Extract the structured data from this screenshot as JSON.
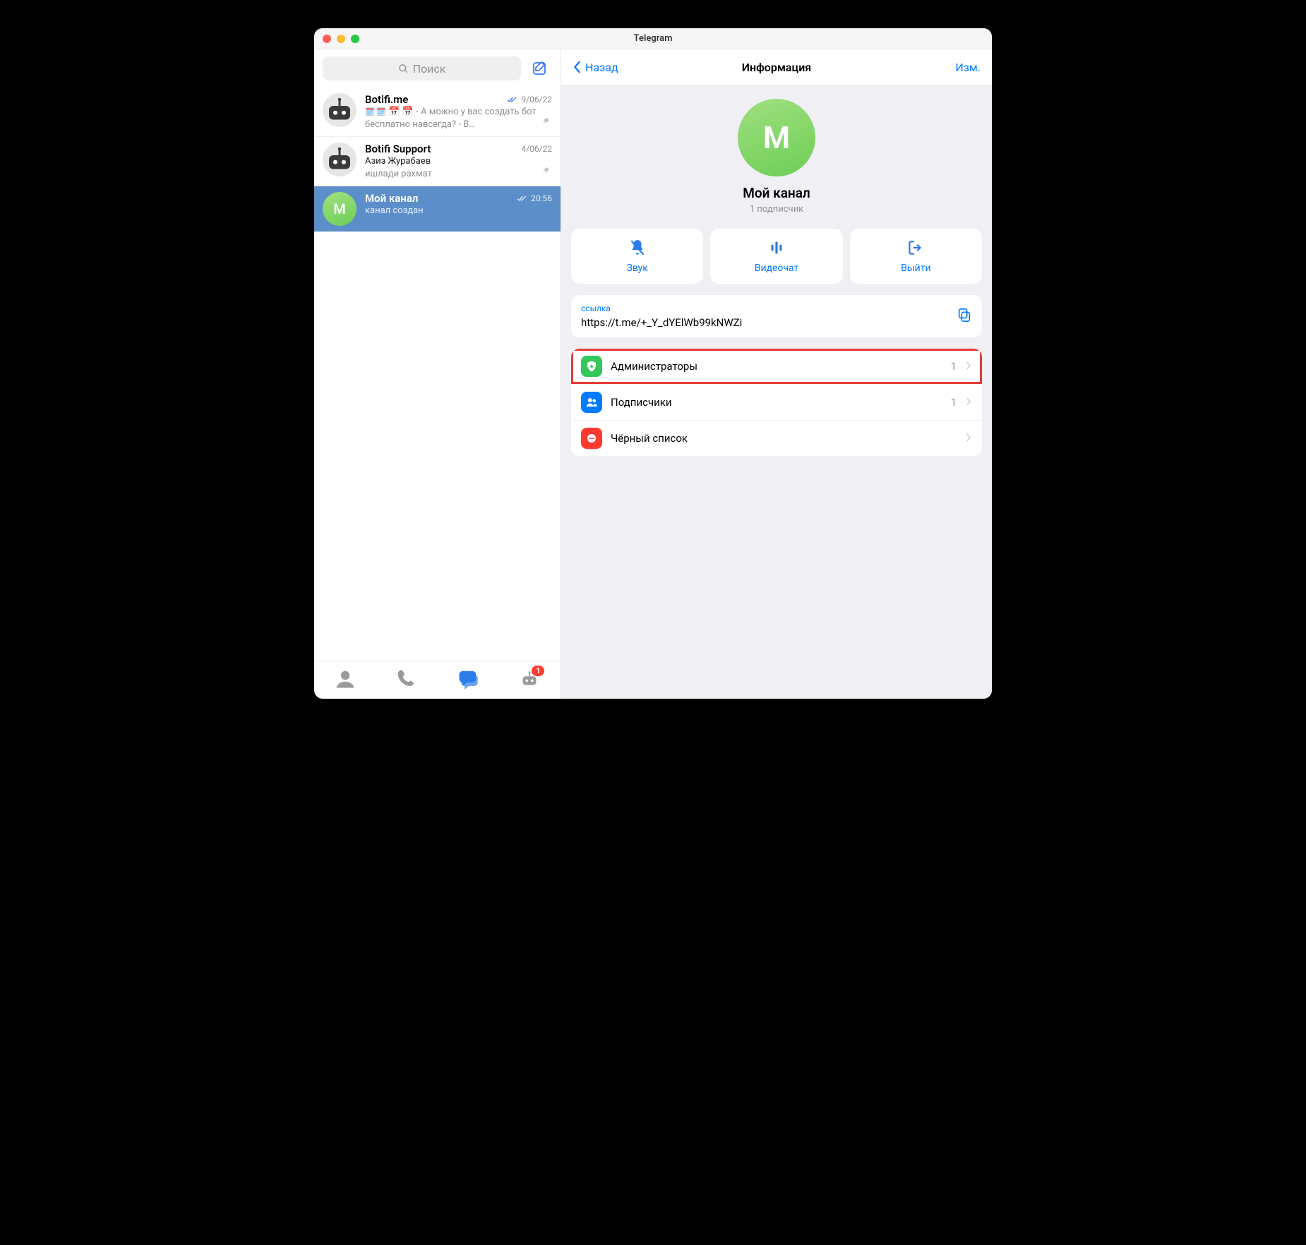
{
  "titlebar": {
    "title": "Telegram"
  },
  "search": {
    "placeholder": "Поиск"
  },
  "chats": [
    {
      "name": "Botifi.me",
      "time": "9/06/22",
      "preview": "📅 📅 - А можно у вас создать бот бесплатно навсегда? - В…",
      "read": true,
      "pin": true,
      "avatar": "bot"
    },
    {
      "name": "Botifi Support",
      "time": "4/06/22",
      "preview_author": "Азиз Журабаев",
      "preview_text": "ишлади рахмат",
      "read": false,
      "pin": true,
      "avatar": "bot"
    },
    {
      "name": "Мой канал",
      "time": "20:56",
      "preview_text": "канал создан",
      "read": true,
      "pin": false,
      "avatar": "M",
      "active": true
    }
  ],
  "bottombar": {
    "badge": "1"
  },
  "header": {
    "back": "Назад",
    "title": "Информация",
    "edit": "Изм."
  },
  "channel": {
    "initial": "M",
    "name": "Мой канал",
    "subscribers": "1 подписчик"
  },
  "actions": {
    "sound": "Звук",
    "video": "Видеочат",
    "leave": "Выйти"
  },
  "link": {
    "caption": "ссылка",
    "url": "https://t.me/+_Y_dYElWb99kNWZi"
  },
  "manage": {
    "admins": {
      "label": "Администраторы",
      "count": "1"
    },
    "subs": {
      "label": "Подписчики",
      "count": "1"
    },
    "bl": {
      "label": "Чёрный список",
      "count": ""
    }
  }
}
